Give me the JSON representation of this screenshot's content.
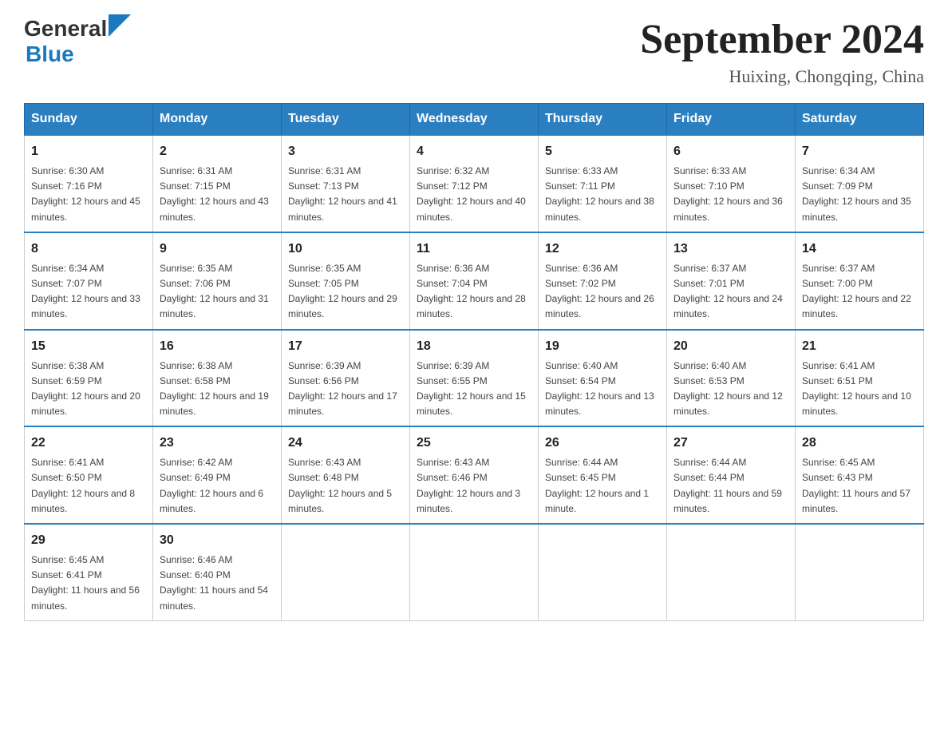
{
  "header": {
    "logo_general": "General",
    "logo_blue": "Blue",
    "title": "September 2024",
    "subtitle": "Huixing, Chongqing, China"
  },
  "weekdays": [
    "Sunday",
    "Monday",
    "Tuesday",
    "Wednesday",
    "Thursday",
    "Friday",
    "Saturday"
  ],
  "weeks": [
    [
      {
        "day": "1",
        "sunrise": "6:30 AM",
        "sunset": "7:16 PM",
        "daylight": "12 hours and 45 minutes."
      },
      {
        "day": "2",
        "sunrise": "6:31 AM",
        "sunset": "7:15 PM",
        "daylight": "12 hours and 43 minutes."
      },
      {
        "day": "3",
        "sunrise": "6:31 AM",
        "sunset": "7:13 PM",
        "daylight": "12 hours and 41 minutes."
      },
      {
        "day": "4",
        "sunrise": "6:32 AM",
        "sunset": "7:12 PM",
        "daylight": "12 hours and 40 minutes."
      },
      {
        "day": "5",
        "sunrise": "6:33 AM",
        "sunset": "7:11 PM",
        "daylight": "12 hours and 38 minutes."
      },
      {
        "day": "6",
        "sunrise": "6:33 AM",
        "sunset": "7:10 PM",
        "daylight": "12 hours and 36 minutes."
      },
      {
        "day": "7",
        "sunrise": "6:34 AM",
        "sunset": "7:09 PM",
        "daylight": "12 hours and 35 minutes."
      }
    ],
    [
      {
        "day": "8",
        "sunrise": "6:34 AM",
        "sunset": "7:07 PM",
        "daylight": "12 hours and 33 minutes."
      },
      {
        "day": "9",
        "sunrise": "6:35 AM",
        "sunset": "7:06 PM",
        "daylight": "12 hours and 31 minutes."
      },
      {
        "day": "10",
        "sunrise": "6:35 AM",
        "sunset": "7:05 PM",
        "daylight": "12 hours and 29 minutes."
      },
      {
        "day": "11",
        "sunrise": "6:36 AM",
        "sunset": "7:04 PM",
        "daylight": "12 hours and 28 minutes."
      },
      {
        "day": "12",
        "sunrise": "6:36 AM",
        "sunset": "7:02 PM",
        "daylight": "12 hours and 26 minutes."
      },
      {
        "day": "13",
        "sunrise": "6:37 AM",
        "sunset": "7:01 PM",
        "daylight": "12 hours and 24 minutes."
      },
      {
        "day": "14",
        "sunrise": "6:37 AM",
        "sunset": "7:00 PM",
        "daylight": "12 hours and 22 minutes."
      }
    ],
    [
      {
        "day": "15",
        "sunrise": "6:38 AM",
        "sunset": "6:59 PM",
        "daylight": "12 hours and 20 minutes."
      },
      {
        "day": "16",
        "sunrise": "6:38 AM",
        "sunset": "6:58 PM",
        "daylight": "12 hours and 19 minutes."
      },
      {
        "day": "17",
        "sunrise": "6:39 AM",
        "sunset": "6:56 PM",
        "daylight": "12 hours and 17 minutes."
      },
      {
        "day": "18",
        "sunrise": "6:39 AM",
        "sunset": "6:55 PM",
        "daylight": "12 hours and 15 minutes."
      },
      {
        "day": "19",
        "sunrise": "6:40 AM",
        "sunset": "6:54 PM",
        "daylight": "12 hours and 13 minutes."
      },
      {
        "day": "20",
        "sunrise": "6:40 AM",
        "sunset": "6:53 PM",
        "daylight": "12 hours and 12 minutes."
      },
      {
        "day": "21",
        "sunrise": "6:41 AM",
        "sunset": "6:51 PM",
        "daylight": "12 hours and 10 minutes."
      }
    ],
    [
      {
        "day": "22",
        "sunrise": "6:41 AM",
        "sunset": "6:50 PM",
        "daylight": "12 hours and 8 minutes."
      },
      {
        "day": "23",
        "sunrise": "6:42 AM",
        "sunset": "6:49 PM",
        "daylight": "12 hours and 6 minutes."
      },
      {
        "day": "24",
        "sunrise": "6:43 AM",
        "sunset": "6:48 PM",
        "daylight": "12 hours and 5 minutes."
      },
      {
        "day": "25",
        "sunrise": "6:43 AM",
        "sunset": "6:46 PM",
        "daylight": "12 hours and 3 minutes."
      },
      {
        "day": "26",
        "sunrise": "6:44 AM",
        "sunset": "6:45 PM",
        "daylight": "12 hours and 1 minute."
      },
      {
        "day": "27",
        "sunrise": "6:44 AM",
        "sunset": "6:44 PM",
        "daylight": "11 hours and 59 minutes."
      },
      {
        "day": "28",
        "sunrise": "6:45 AM",
        "sunset": "6:43 PM",
        "daylight": "11 hours and 57 minutes."
      }
    ],
    [
      {
        "day": "29",
        "sunrise": "6:45 AM",
        "sunset": "6:41 PM",
        "daylight": "11 hours and 56 minutes."
      },
      {
        "day": "30",
        "sunrise": "6:46 AM",
        "sunset": "6:40 PM",
        "daylight": "11 hours and 54 minutes."
      },
      null,
      null,
      null,
      null,
      null
    ]
  ],
  "labels": {
    "sunrise": "Sunrise:",
    "sunset": "Sunset:",
    "daylight": "Daylight:"
  }
}
